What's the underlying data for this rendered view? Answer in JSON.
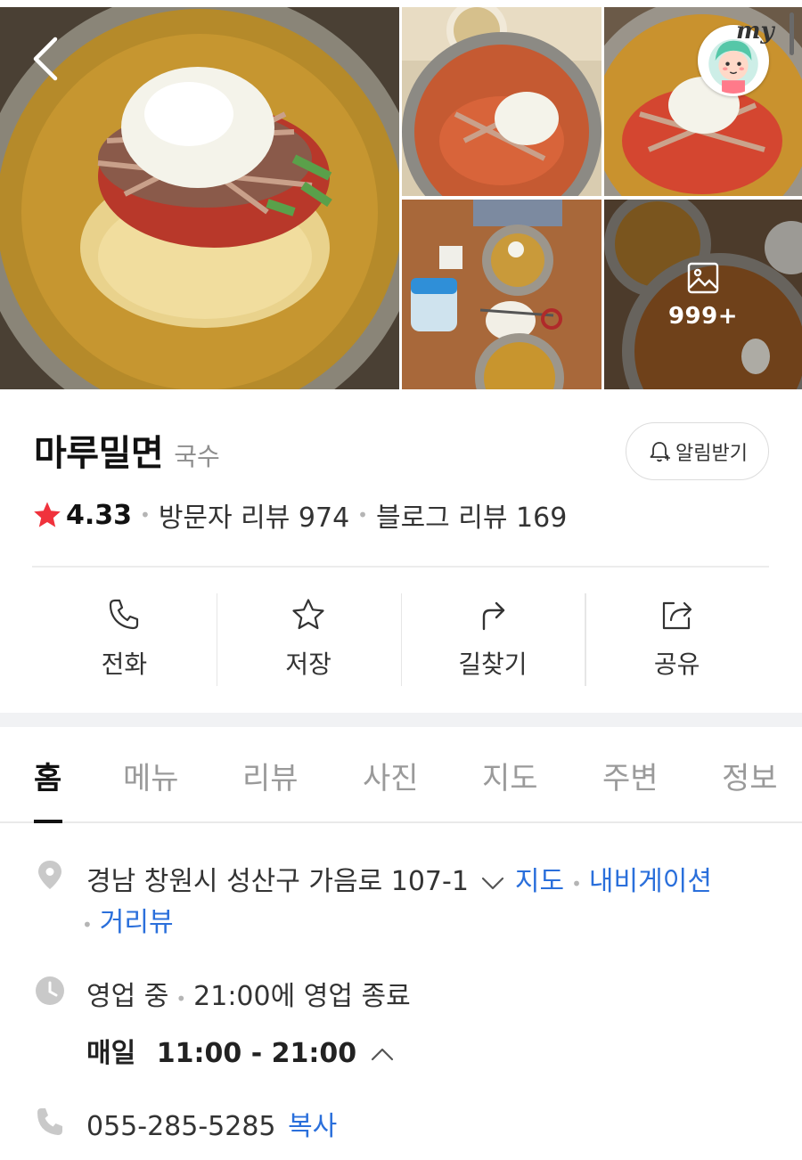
{
  "gallery": {
    "more_count": "999+",
    "my_label": "my"
  },
  "place": {
    "name": "마루밀면",
    "category": "국수",
    "alarm_label": "알림받기"
  },
  "rating": {
    "score": "4.33",
    "visitor_reviews": "방문자 리뷰 974",
    "blog_reviews": "블로그 리뷰 169"
  },
  "actions": [
    {
      "label": "전화",
      "icon": "phone-icon"
    },
    {
      "label": "저장",
      "icon": "star-outline-icon"
    },
    {
      "label": "길찾기",
      "icon": "directions-icon"
    },
    {
      "label": "공유",
      "icon": "share-icon"
    }
  ],
  "tabs": [
    "홈",
    "메뉴",
    "리뷰",
    "사진",
    "지도",
    "주변",
    "정보"
  ],
  "info": {
    "address": "경남 창원시 성산구 가음로 107-1",
    "map_link": "지도",
    "nav_link": "내비게이션",
    "street_view_link": "거리뷰",
    "status": "영업 중",
    "status_detail": "21:00에 영업 종료",
    "hours_day": "매일",
    "hours_time": "11:00 - 21:00",
    "phone": "055-285-5285",
    "copy_label": "복사"
  },
  "colors": {
    "link": "#2a6fdb",
    "star": "#f0323c",
    "accent_text": "#111111"
  }
}
